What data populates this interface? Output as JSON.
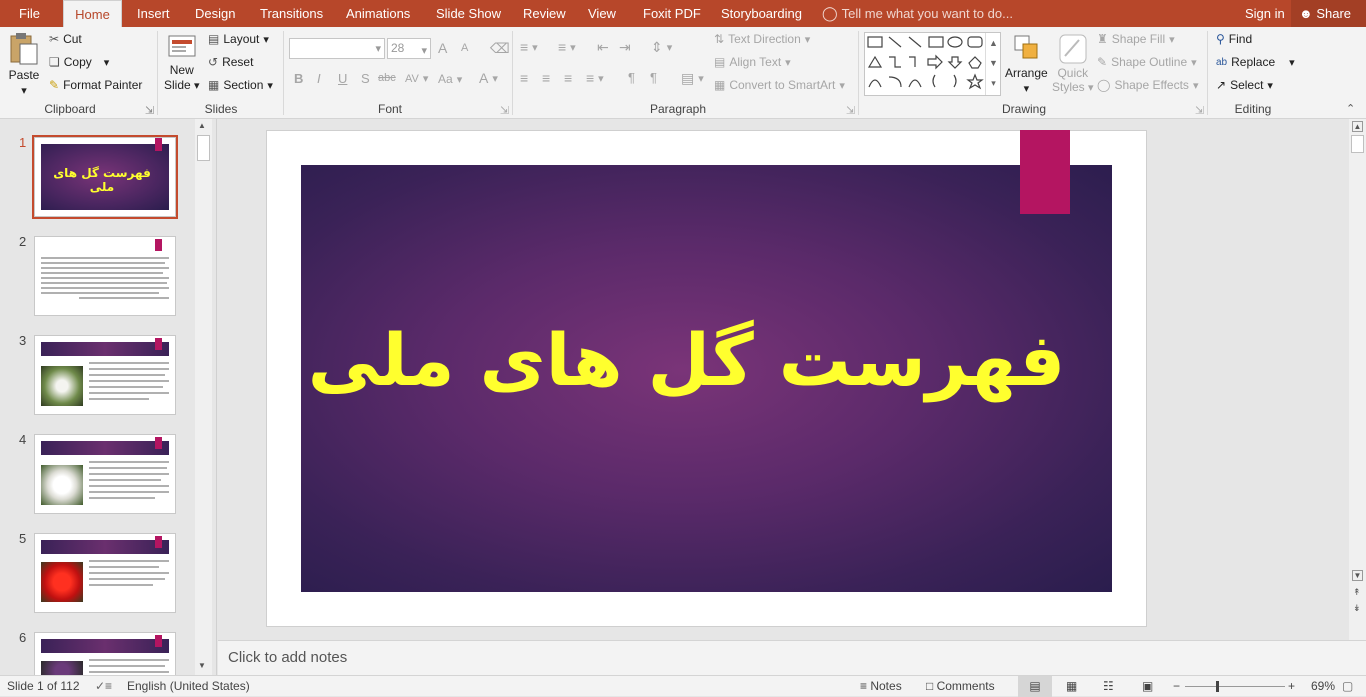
{
  "tabs": {
    "file": "File",
    "home": "Home",
    "insert": "Insert",
    "design": "Design",
    "transitions": "Transitions",
    "animations": "Animations",
    "slideshow": "Slide Show",
    "review": "Review",
    "view": "View",
    "foxit": "Foxit PDF",
    "storyboarding": "Storyboarding",
    "tellme": "Tell me what you want to do...",
    "signin": "Sign in",
    "share": "Share"
  },
  "ribbon": {
    "clipboard": {
      "paste": "Paste",
      "cut": "Cut",
      "copy": "Copy",
      "format_painter": "Format Painter",
      "label": "Clipboard"
    },
    "slides": {
      "new_slide_1": "New",
      "new_slide_2": "Slide",
      "layout": "Layout",
      "reset": "Reset",
      "section": "Section",
      "label": "Slides"
    },
    "font": {
      "font_name": "",
      "font_size": "28",
      "bold": "B",
      "italic": "I",
      "underline": "U",
      "shadow": "S",
      "strike": "abc",
      "spacing": "AV",
      "case": "Aa",
      "color": "A",
      "grow": "A",
      "shrink": "A",
      "label": "Font"
    },
    "paragraph": {
      "text_direction": "Text Direction",
      "align_text": "Align Text",
      "convert_smartart": "Convert to SmartArt",
      "label": "Paragraph"
    },
    "drawing": {
      "arrange": "Arrange",
      "quick_styles_1": "Quick",
      "quick_styles_2": "Styles",
      "shape_fill": "Shape Fill",
      "shape_outline": "Shape Outline",
      "shape_effects": "Shape Effects",
      "label": "Drawing"
    },
    "editing": {
      "find": "Find",
      "replace": "Replace",
      "select": "Select",
      "label": "Editing"
    }
  },
  "thumbnails": [
    {
      "num": "1",
      "title": "فهرست گل های ملی"
    },
    {
      "num": "2"
    },
    {
      "num": "3"
    },
    {
      "num": "4"
    },
    {
      "num": "5"
    },
    {
      "num": "6"
    }
  ],
  "slide": {
    "title": "فهرست گل های ملی"
  },
  "notes": {
    "placeholder": "Click to add notes"
  },
  "status": {
    "slide_info": "Slide 1 of 112",
    "language": "English (United States)",
    "notes": "Notes",
    "comments": "Comments",
    "zoom": "69%"
  },
  "colors": {
    "accent": "#b7472a",
    "slide_title": "#ffff2e",
    "bookmark": "#b41561"
  }
}
